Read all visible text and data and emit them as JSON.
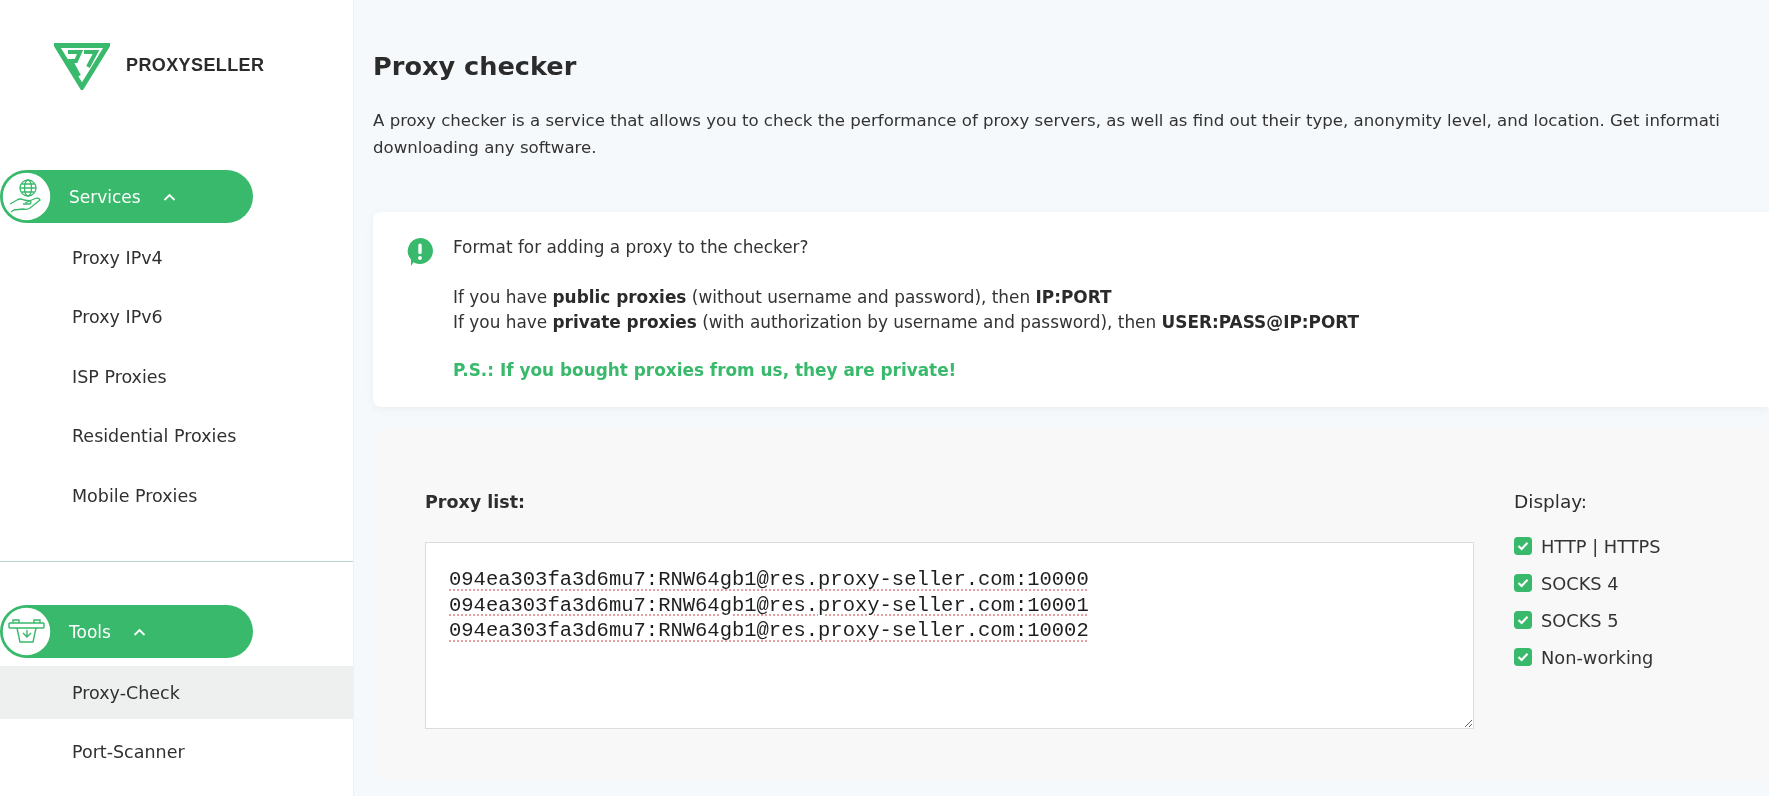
{
  "logo": {
    "text": "PROXYSELLER"
  },
  "sidebar": {
    "sections": [
      {
        "label": "Services",
        "expanded": true,
        "items": [
          {
            "label": "Proxy IPv4",
            "selected": false
          },
          {
            "label": "Proxy IPv6",
            "selected": false
          },
          {
            "label": "ISP Proxies",
            "selected": false
          },
          {
            "label": "Residential Proxies",
            "selected": false
          },
          {
            "label": "Mobile Proxies",
            "selected": false
          }
        ]
      },
      {
        "label": "Tools",
        "expanded": true,
        "items": [
          {
            "label": "Proxy-Check",
            "selected": true
          },
          {
            "label": "Port-Scanner",
            "selected": false
          }
        ]
      }
    ]
  },
  "page": {
    "title": "Proxy checker",
    "description_lines": [
      "A proxy checker is a service that allows you to check the performance of proxy servers, as well as find out their type, anonymity level, and location. Get informati",
      "downloading any software."
    ]
  },
  "notice": {
    "question": "Format for adding a proxy to the checker?",
    "lines": [
      "If you have **public proxies** (without username and password), then **IP:PORT**",
      "If you have **private proxies** (with authorization by username and password), then **USER:PASS@IP:PORT**"
    ],
    "note": "P.S.: If you bought proxies from us, they are private!"
  },
  "checker": {
    "proxy_list": {
      "label": "Proxy list:",
      "value": "094ea303fa3d6mu7:RNW64gb1@res.proxy-seller.com:10000\n094ea303fa3d6mu7:RNW64gb1@res.proxy-seller.com:10001\n094ea303fa3d6mu7:RNW64gb1@res.proxy-seller.com:10002"
    },
    "display": {
      "label": "Display:",
      "options": [
        {
          "label": "HTTP | HTTPS",
          "checked": true
        },
        {
          "label": "SOCKS 4",
          "checked": true
        },
        {
          "label": "SOCKS 5",
          "checked": true
        },
        {
          "label": "Non-working",
          "checked": true
        }
      ]
    }
  }
}
